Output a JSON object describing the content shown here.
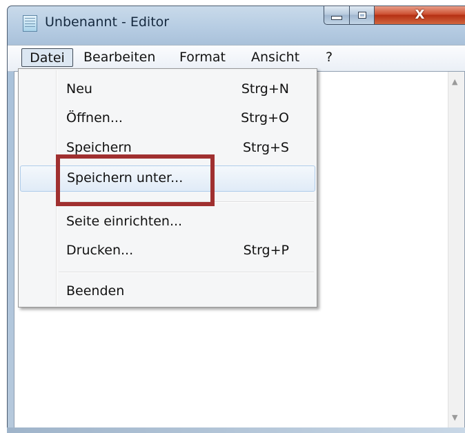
{
  "window": {
    "title": "Unbenannt - Editor",
    "icons": {
      "app": "notepad-icon",
      "minimize": "minimize-icon",
      "maximize": "maximize-icon",
      "close": "close-icon"
    },
    "close_glyph": "X"
  },
  "menubar": {
    "items": [
      "Datei",
      "Bearbeiten",
      "Format",
      "Ansicht",
      "?"
    ],
    "active": "Datei"
  },
  "file_menu": {
    "items": [
      {
        "label": "Neu",
        "shortcut": "Strg+N"
      },
      {
        "label": "Öffnen...",
        "shortcut": "Strg+O"
      },
      {
        "label": "Speichern",
        "shortcut": "Strg+S"
      },
      {
        "label": "Speichern unter...",
        "shortcut": "",
        "highlighted": true
      },
      {
        "label": "Seite einrichten...",
        "shortcut": ""
      },
      {
        "label": "Drucken...",
        "shortcut": "Strg+P"
      },
      {
        "label": "Beenden",
        "shortcut": ""
      }
    ]
  },
  "scrollbar": {
    "up_icon": "scroll-up-arrow-icon",
    "down_icon": "scroll-down-arrow-icon"
  },
  "annotation": {
    "color": "#a03030",
    "target": "Speichern unter..."
  }
}
